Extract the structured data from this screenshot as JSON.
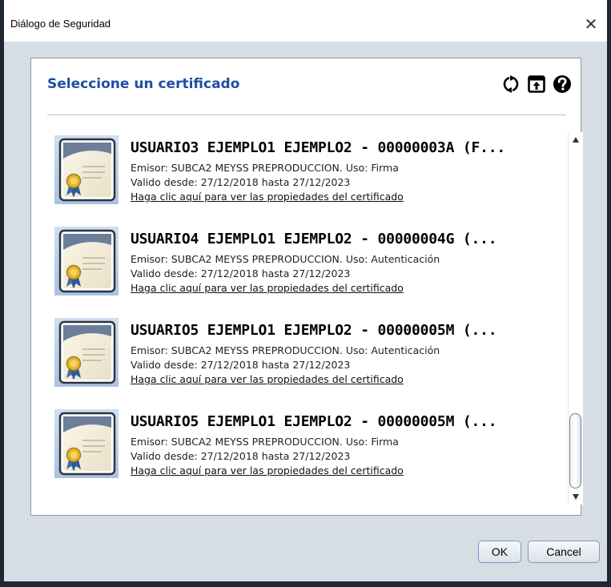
{
  "window": {
    "title": "Diálogo de Seguridad",
    "close_glyph": "✕"
  },
  "panel": {
    "title": "Seleccione un certificado",
    "tools": [
      "refresh-icon",
      "import-icon",
      "help-icon"
    ]
  },
  "certificates": [
    {
      "title": "USUARIO3 EJEMPLO1 EJEMPLO2 - 00000003A (F...",
      "issuer": "Emisor: SUBCA2 MEYSS PREPRODUCCION. Uso: Firma",
      "validity": "Valido desde: 27/12/2018 hasta 27/12/2023",
      "link": "Haga clic aquí para ver las propiedades del certificado"
    },
    {
      "title": "USUARIO4 EJEMPLO1 EJEMPLO2 - 00000004G (...",
      "issuer": "Emisor: SUBCA2 MEYSS PREPRODUCCION. Uso: Autenticación",
      "validity": "Valido desde: 27/12/2018 hasta 27/12/2023",
      "link": "Haga clic aquí para ver las propiedades del certificado"
    },
    {
      "title": "USUARIO5 EJEMPLO1 EJEMPLO2 - 00000005M (...",
      "issuer": "Emisor: SUBCA2 MEYSS PREPRODUCCION. Uso: Autenticación",
      "validity": "Valido desde: 27/12/2018 hasta 27/12/2023",
      "link": "Haga clic aquí para ver las propiedades del certificado"
    },
    {
      "title": "USUARIO5 EJEMPLO1 EJEMPLO2 - 00000005M (...",
      "issuer": "Emisor: SUBCA2 MEYSS PREPRODUCCION. Uso: Firma",
      "validity": "Valido desde: 27/12/2018 hasta 27/12/2023",
      "link": "Haga clic aquí para ver las propiedades del certificado"
    }
  ],
  "scroll": {
    "position": 1.0,
    "visible_fraction": 0.22
  },
  "buttons": {
    "ok": "OK",
    "cancel": "Cancel"
  },
  "colors": {
    "accent_title": "#1f4fa3",
    "window_bg": "#d7dde5"
  }
}
